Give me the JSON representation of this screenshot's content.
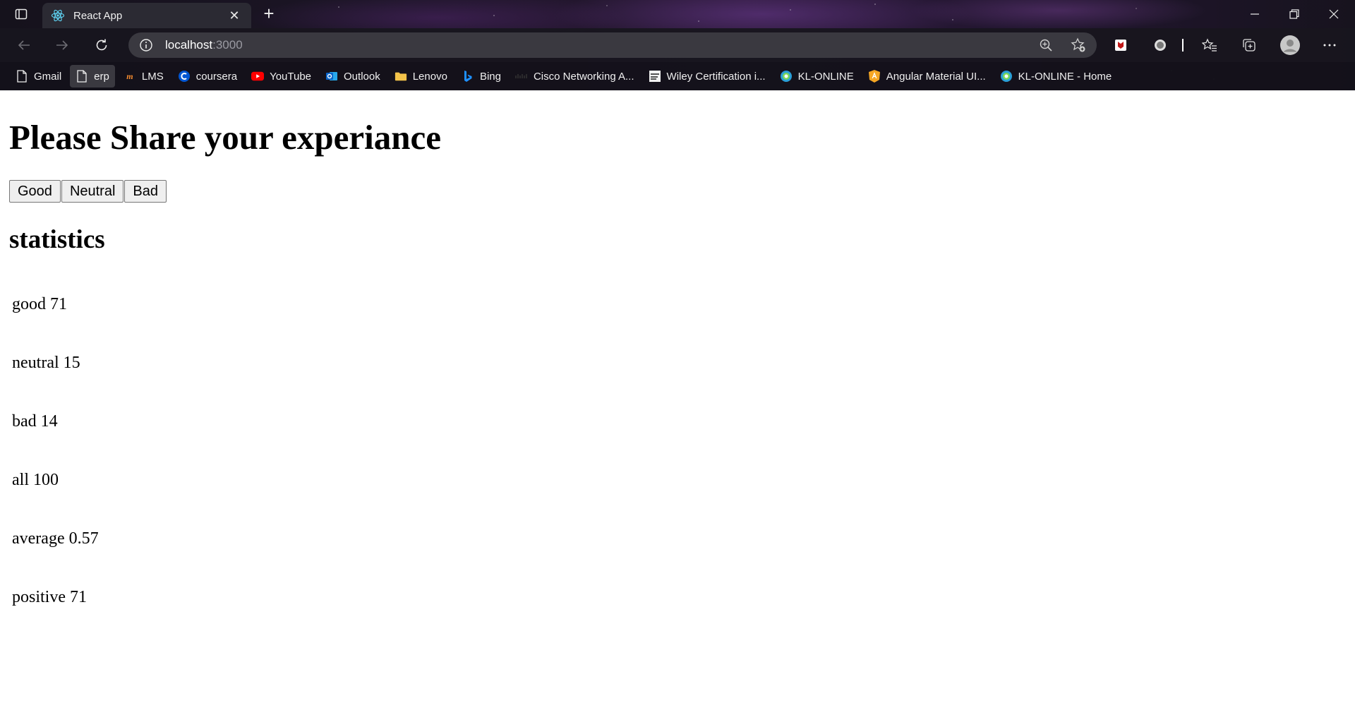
{
  "browser": {
    "tab": {
      "title": "React App",
      "favicon": "react-icon"
    },
    "address": {
      "host": "localhost",
      "port": ":3000"
    },
    "bookmarks": [
      {
        "label": "Gmail",
        "icon": "page-icon"
      },
      {
        "label": "erp",
        "icon": "page-icon"
      },
      {
        "label": "LMS",
        "icon": "lms-icon"
      },
      {
        "label": "coursera",
        "icon": "coursera-icon"
      },
      {
        "label": "YouTube",
        "icon": "youtube-icon"
      },
      {
        "label": "Outlook",
        "icon": "outlook-icon"
      },
      {
        "label": "Lenovo",
        "icon": "folder-icon"
      },
      {
        "label": "Bing",
        "icon": "bing-icon"
      },
      {
        "label": "Cisco Networking A...",
        "icon": "cisco-icon"
      },
      {
        "label": "Wiley Certification i...",
        "icon": "wiley-icon"
      },
      {
        "label": "KL-ONLINE",
        "icon": "kl-icon"
      },
      {
        "label": "Angular Material UI...",
        "icon": "angular-icon"
      },
      {
        "label": "KL-ONLINE - Home",
        "icon": "kl-icon"
      }
    ]
  },
  "page": {
    "title": "Please Share your experiance",
    "buttons": {
      "good": "Good",
      "neutral": "Neutral",
      "bad": "Bad"
    },
    "statistics_heading": "statistics",
    "stats": {
      "good": "good 71",
      "neutral": "neutral 15",
      "bad": "bad 14",
      "all": "all 100",
      "average": "average 0.57",
      "positive": "positive 71"
    }
  },
  "colors": {
    "youtube": "#ff0000",
    "coursera": "#0056d2",
    "outlook": "#0a64c8",
    "angular": "#f5a623",
    "folder": "#f3c34a"
  }
}
